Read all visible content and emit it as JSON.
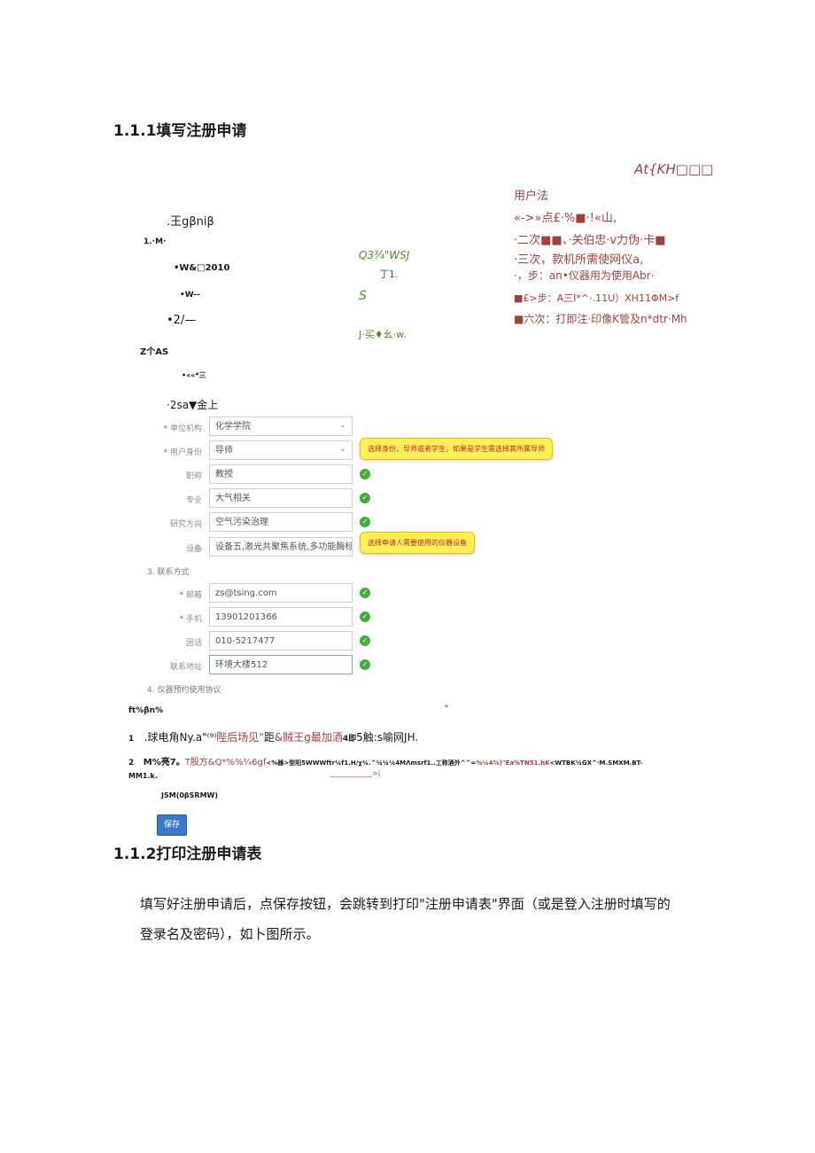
{
  "heading1": "1.1.1填写注册申请",
  "heading2": "1.1.2打印注册申请表",
  "right_block": {
    "title": "At{KH□□□",
    "lines": [
      "用户法",
      "«->»点£·%■·!«山,",
      "·二次■■、·关伯忠·v力伪·卡■",
      "·三次，款机所需使网仪a,",
      "·，步：an•仪器用为使用Abr·",
      "■£>步：A三I*^·.11U）XH11ΦM>f",
      "■六次：打即注·印像K管及n*dtr·Mh"
    ]
  },
  "left_block": {
    "l1": ".王gβniβ",
    "l2": "1.·M·",
    "l3": "•W&□2010",
    "l4": "•W--",
    "l5": "•2/—",
    "l6": "Z个AS",
    "l7": "•««*三",
    "l8": "·2sa▼金上"
  },
  "mid_block": {
    "m1": "Q3¾\"WSJ",
    "m2": "丁1.",
    "m3": "S",
    "m4": "J·买♦幺·w."
  },
  "form": {
    "fields": [
      {
        "label": "单位机构",
        "value": "化学学院",
        "select": true,
        "required": true
      },
      {
        "label": "用户身份",
        "value": "导师",
        "select": true,
        "required": true
      },
      {
        "label": "职称",
        "value": "教授",
        "select": false,
        "required": false
      },
      {
        "label": "专业",
        "value": "大气相关",
        "select": false,
        "required": false
      },
      {
        "label": "研究方向",
        "value": "空气污染治理",
        "select": false,
        "required": false
      },
      {
        "label": "设备",
        "value": "设备五,激光共聚焦系统,多功能酶标仪",
        "select": false,
        "required": false
      }
    ],
    "contact_section": "3. 联系方式",
    "contact_fields": [
      {
        "label": "邮箱",
        "value": "zs@tsing.com",
        "required": true
      },
      {
        "label": "手机",
        "value": "13901201366",
        "required": true
      },
      {
        "label": "固话",
        "value": "010-5217477",
        "required": false
      },
      {
        "label": "联系地址",
        "value": "环境大楼512",
        "required": false
      }
    ],
    "agreement_section": "4. 仪器预约使用协议",
    "tip1": "选择身份，导师或者学生，如果是学生需选择其所属导师",
    "tip2": "选择申请人需要使用的仪器设备"
  },
  "footer_block": {
    "f0": "ft%βn%",
    "f0b": "\"",
    "f1_num": "1",
    "f1_a": ".球电角Ny.a\"⁽⁹⁾",
    "f1_b": "陛后场见\"",
    "f1_c": "距",
    "f1_d": "&贼王g最加酒",
    "f1_e": "4即",
    "f1_f": "5触:s喻网JH.",
    "f2_num": "2",
    "f2_a": "M%亮7。",
    "f2_b": "T殷方&Q*%%¼6gf",
    "f2_c": "<%器>型阳5WWWftr¼f1.H/χ¾.^¼¼¼4MΛmsrf1..工称酒外^^=",
    "f2_d": "%¼4⅝)\"Ea%TN51.hK",
    "f2_e": "<WTBK¼GX^·M.SMXM.BT-",
    "f2_line2": "MM1.k.",
    "f2_link": "____________>|",
    "f3": "JSM(0βSRMW)",
    "save": "保存"
  },
  "paragraph": {
    "line1": "填写好注册申请后，点保存按钮，会跳转到打印\"注册申请表\"界面（或是登入注册时填写的",
    "line2": "登录名及密码），如卜图所示。"
  }
}
